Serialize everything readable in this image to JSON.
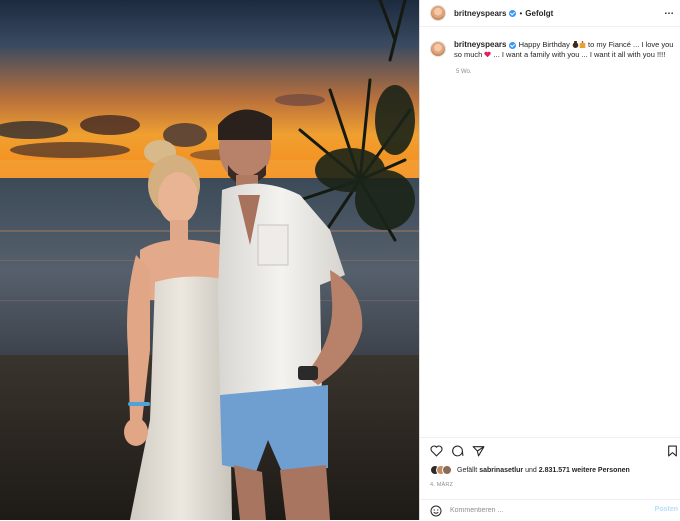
{
  "post": {
    "username": "britneyspears",
    "follow_status": "Gefolgt",
    "separator": "•",
    "more_label": "…"
  },
  "caption": {
    "username": "britneyspears",
    "part1": "Happy Birthday",
    "part2": "to my Fiancé ... I love you so much",
    "part3": "... I want a family with you ... I want it all with you !!!!",
    "time_ago": "5 Wo."
  },
  "likes": {
    "prefix": "Gefällt",
    "user": "sabrinasetlur",
    "connector": "und",
    "count": "2.831.571 weitere Personen"
  },
  "post_date": "4. MÄRZ",
  "comment_box": {
    "placeholder": "Kommentieren ...",
    "post_label": "Posten"
  },
  "icons": [
    "more-icon",
    "heart-icon",
    "comment-icon",
    "share-icon",
    "bookmark-icon",
    "emoji-icon",
    "verified-icon"
  ],
  "colors": {
    "verified": "#3897f0",
    "post_button": "#b2dffc",
    "heart_emoji": "#e0245e"
  }
}
